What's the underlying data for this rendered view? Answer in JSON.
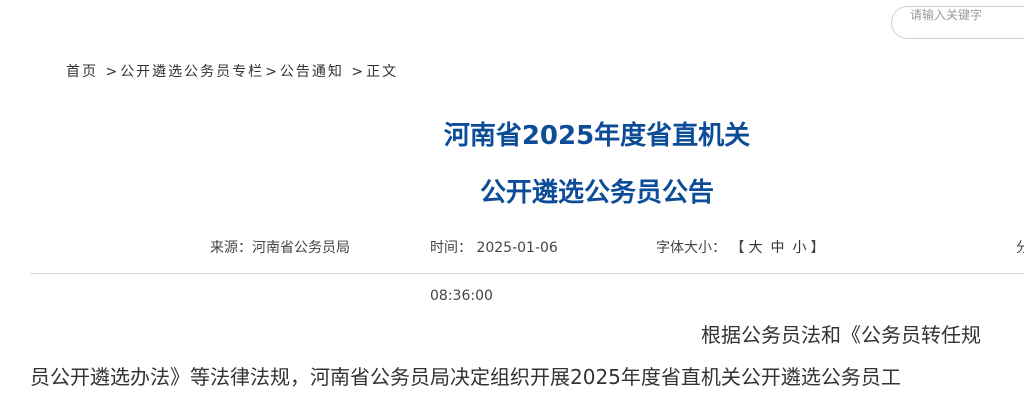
{
  "search": {
    "placeholder": "请输入关键字"
  },
  "breadcrumb": {
    "items": [
      "首页",
      "公开遴选公务员专栏",
      "公告通知",
      "正文"
    ],
    "separator": ">"
  },
  "article": {
    "title_line1": "河南省2025年度省直机关",
    "title_line2": "公开遴选公务员公告",
    "source_label": "来源：",
    "source_value": "河南省公务员局",
    "time_label": "时间：",
    "time_date": "2025-01-06",
    "time_clock": "08:36:00",
    "font_size_label": "字体大小：",
    "font_bracket_open": "【",
    "font_bracket_close": "】",
    "font_sizes": [
      "大",
      "中",
      "小"
    ],
    "extra_label": "分",
    "paragraph_line1": "根据公务员法和《公务员转任规",
    "paragraph_line2": "员公开遴选办法》等法律法规，河南省公务员局决定组织开展2025年度省直机关公开遴选公务员工"
  },
  "colors": {
    "title": "#0d4c97",
    "text": "#333333",
    "divider": "#d6d6d6",
    "search_border": "#cfcfcf"
  }
}
